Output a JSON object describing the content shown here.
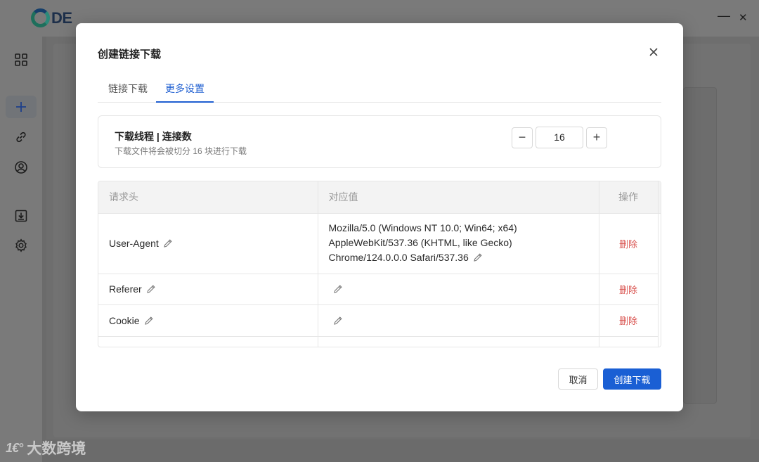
{
  "app": {
    "logo_text": "DE",
    "window_minimize": "—",
    "window_close": "✕"
  },
  "sidebar": {
    "icons": [
      "dashboard-icon",
      "plus-icon",
      "link-icon",
      "user-icon",
      "download-icon",
      "gear-icon"
    ]
  },
  "watermark": {
    "mark": "1€°",
    "text": "大数跨境"
  },
  "modal": {
    "title": "创建链接下载",
    "close": "✕",
    "tabs": [
      {
        "label": "链接下载",
        "active": false
      },
      {
        "label": "更多设置",
        "active": true
      }
    ],
    "threads": {
      "title": "下载线程 | 连接数",
      "description": "下载文件将会被切分 16 块进行下载",
      "value": "16",
      "minus": "−",
      "plus": "+"
    },
    "headers_table": {
      "columns": [
        "请求头",
        "对应值",
        "操作"
      ],
      "rows": [
        {
          "key": "User-Agent",
          "value_lines": [
            "Mozilla/5.0 (Windows NT 10.0; Win64; x64)",
            "AppleWebKit/537.36 (KHTML, like Gecko)",
            "Chrome/124.0.0.0 Safari/537.36"
          ],
          "action": "删除"
        },
        {
          "key": "Referer",
          "value_lines": [
            ""
          ],
          "action": "删除"
        },
        {
          "key": "Cookie",
          "value_lines": [
            ""
          ],
          "action": "删除"
        }
      ]
    },
    "buttons": {
      "cancel": "取消",
      "create": "创建下载"
    }
  },
  "colors": {
    "accent": "#1a5fd4",
    "danger": "#d9534f"
  }
}
